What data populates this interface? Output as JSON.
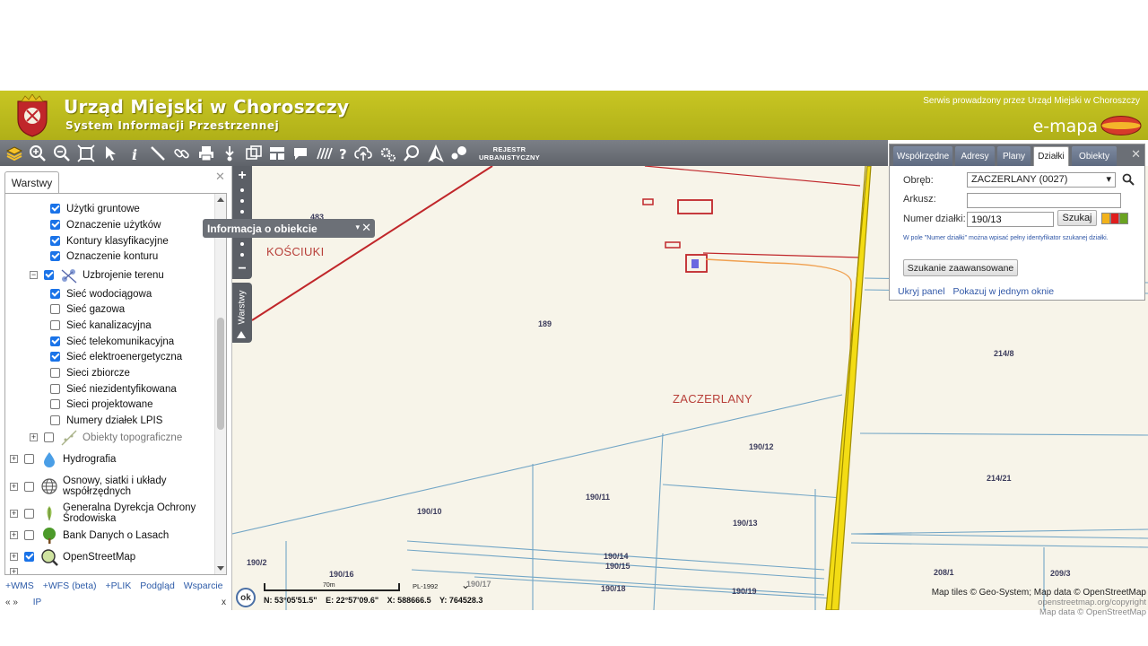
{
  "header": {
    "title": "Urząd Miejski w Choroszczy",
    "subtitle": "System Informacji Przestrzennej",
    "service_note": "Serwis prowadzony przez Urząd Miejski w Choroszczy",
    "logo_text": "e-mapa",
    "brand_color": "#b9b81c"
  },
  "toolbar": {
    "tools": [
      "layers-icon",
      "zoom-in-icon",
      "zoom-out-icon",
      "zoom-extent-icon",
      "select-pointer-icon",
      "info-icon",
      "measure-line-icon",
      "link-icon",
      "print-icon",
      "download-icon",
      "copy-icon",
      "layout-icon",
      "speech-bubble-icon",
      "hatch-icon",
      "help-icon",
      "cloud-upload-icon",
      "settings-icon",
      "search-map-icon",
      "north-arrow-icon",
      "messages-icon"
    ],
    "rejestr_line1": "REJESTR",
    "rejestr_line2": "URBANISTYCZNY"
  },
  "left_panel": {
    "tab": "Warstwy",
    "close": "✕",
    "layers": [
      {
        "label": "Użytki gruntowe",
        "checked": true
      },
      {
        "label": "Oznaczenie użytków",
        "checked": true
      },
      {
        "label": "Kontury klasyfikacyjne",
        "checked": true
      },
      {
        "label": "Oznaczenie konturu",
        "checked": true
      },
      {
        "label": "Uzbrojenie terenu",
        "checked": true
      },
      {
        "label": "Sieć wodociągowa",
        "checked": true
      },
      {
        "label": "Sieć gazowa",
        "checked": false
      },
      {
        "label": "Sieć kanalizacyjna",
        "checked": false
      },
      {
        "label": "Sieć telekomunikacyjna",
        "checked": true
      },
      {
        "label": "Sieć elektroenergetyczna",
        "checked": true
      },
      {
        "label": "Sieci zbiorcze",
        "checked": false
      },
      {
        "label": "Sieć niezidentyfikowana",
        "checked": false
      },
      {
        "label": "Sieci projektowane",
        "checked": false
      },
      {
        "label": "Numery działek LPIS",
        "checked": false
      },
      {
        "label": "Obiekty topograficzne",
        "checked": false
      },
      {
        "label": "Hydrografia",
        "checked": false
      },
      {
        "label": "Osnowy, siatki i układy",
        "label2": "współrzędnych",
        "checked": false
      },
      {
        "label": "Generalna Dyrekcja Ochrony",
        "label2": "Środowiska",
        "checked": false
      },
      {
        "label": "Bank Danych o Lasach",
        "checked": false
      },
      {
        "label": "OpenStreetMap",
        "checked": true
      }
    ],
    "links": [
      "+WMS",
      "+WFS (beta)",
      "+PLIK",
      "Podgląd",
      "Wsparcie"
    ],
    "bottom_left": "«  »",
    "bottom_ip": "IP",
    "bottom_x": "x"
  },
  "map": {
    "popup_title": "Informacja o obiekcie",
    "popup_dropdown": "▾",
    "popup_close": "✕",
    "layers_vtab": "Warstwy",
    "zoom_in": "+",
    "zoom_out": "−",
    "area_labels": [
      "KOŚCIUKI",
      "ZACZERLANY"
    ],
    "parcel_labels": [
      "483",
      "189",
      "214/8",
      "190/12",
      "190/11",
      "214/21",
      "190/10",
      "190/13",
      "190/2",
      "190/16",
      "190/14",
      "190/15",
      "190/18",
      "190/19",
      "208/1",
      "209/3",
      "190/17"
    ],
    "ok": "ok",
    "scale": "70m",
    "projection": "PL-1992",
    "coord_n": "N: 53°05'51.5\"",
    "coord_e": "E: 22°57'09.6\"",
    "coord_x": "X: 588666.5",
    "coord_y": "Y: 764528.3",
    "attribution_line1": "Map tiles © Geo-System; Map data © OpenStreetMap",
    "attribution_line2": "openstreetmap.org/copyright",
    "attribution_line3": "Map data © OpenStreetMap"
  },
  "search_panel": {
    "tabs": [
      "Współrzędne",
      "Adresy",
      "Plany",
      "Działki",
      "Obiekty"
    ],
    "active_tab": "Działki",
    "close": "✕",
    "obreb_label": "Obręb:",
    "obreb_value": "ZACZERLANY (0027)",
    "arkusz_label": "Arkusz:",
    "arkusz_value": "",
    "numer_label": "Numer działki:",
    "numer_value": "190/13",
    "search_button": "Szukaj",
    "hint": "W pole \"Numer działki\" można wpisać pełny identyfikator szukanej działki.",
    "advanced_button": "Szukanie zaawansowane",
    "link_hide": "Ukryj panel",
    "link_window": "Pokazuj w jednym oknie",
    "colors": [
      "#f2b21b",
      "#e01e1e",
      "#6aa321"
    ]
  }
}
